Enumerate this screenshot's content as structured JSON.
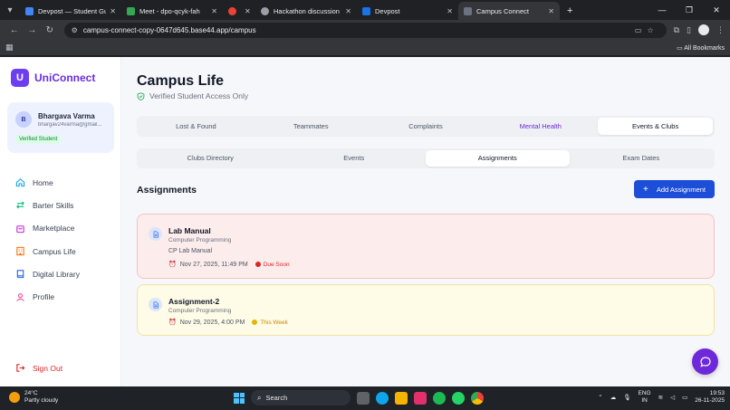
{
  "browser": {
    "tabs": [
      {
        "label": "Devpost — Student Guide for ...",
        "color": "#4285f4",
        "active": false
      },
      {
        "label": "Meet - dpo-qcyk-fah",
        "color": "#34a853",
        "active": false
      },
      {
        "label": "",
        "color": "#ea4335",
        "active": false
      },
      {
        "label": "Hackathon discussion topics",
        "color": "#9aa0a6",
        "active": false
      },
      {
        "label": "Devpost",
        "color": "#003e54",
        "active": false
      },
      {
        "label": "Campus Connect",
        "color": "#4b5563",
        "active": true
      }
    ],
    "new_tab": "+",
    "window_controls": {
      "tabs_menu": "▾",
      "minimize": "—",
      "maximize": "❐",
      "close": "✕"
    },
    "nav": {
      "back": "←",
      "forward": "→",
      "reload": "↻"
    },
    "url": "campus-connect-copy-0647d645.base44.app/campus",
    "apps_icon": "▦",
    "all_bookmarks": "All Bookmarks",
    "bookmarks_icon": "▭"
  },
  "app": {
    "brand": {
      "logo_letter": "U",
      "name": "UniConnect"
    },
    "user": {
      "initial": "B",
      "name": "Bhargava Varma",
      "email": "bhargav24varma@gmail...",
      "badge": "Verified Student"
    },
    "nav": [
      {
        "label": "Home",
        "icon": "home-icon",
        "color": "#0ea5e9"
      },
      {
        "label": "Barter Skills",
        "icon": "swap-icon",
        "color": "#10b981"
      },
      {
        "label": "Marketplace",
        "icon": "bag-icon",
        "color": "#c026d3"
      },
      {
        "label": "Campus Life",
        "icon": "building-icon",
        "color": "#f97316"
      },
      {
        "label": "Digital Library",
        "icon": "book-icon",
        "color": "#2563eb"
      },
      {
        "label": "Profile",
        "icon": "user-icon",
        "color": "#ec4899"
      }
    ],
    "signout": "Sign Out",
    "page": {
      "title": "Campus Life",
      "subtitle": "Verified Student Access Only"
    },
    "main_tabs": [
      "Lost & Found",
      "Teammates",
      "Complaints",
      "Mental Health",
      "Events & Clubs"
    ],
    "main_tab_selected": "Events & Clubs",
    "sub_tabs": [
      "Clubs Directory",
      "Events",
      "Assignments",
      "Exam Dates"
    ],
    "sub_tab_selected": "Assignments",
    "section_title": "Assignments",
    "add_button": "Add Assignment",
    "assignments": [
      {
        "title": "Lab Manual",
        "course": "Computer Programming",
        "description": "CP Lab Manual",
        "due": "Nov 27, 2025, 11:49 PM",
        "status": "Due Soon",
        "status_color": "#dc2626"
      },
      {
        "title": "Assignment-2",
        "course": "Computer Programming",
        "description": "",
        "due": "Nov 29, 2025, 4:00 PM",
        "status": "This Week",
        "status_color": "#ca8a04"
      }
    ]
  },
  "taskbar": {
    "weather": {
      "temp": "24°C",
      "desc": "Partly cloudy"
    },
    "search": "Search",
    "lang": {
      "line1": "ENG",
      "line2": "IN"
    },
    "time": "19:53",
    "date": "26-11-2025"
  }
}
